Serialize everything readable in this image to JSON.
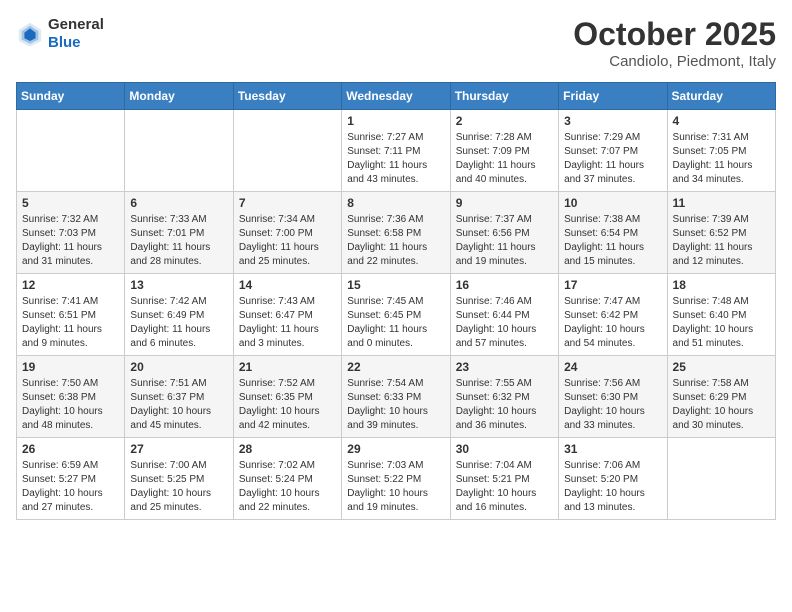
{
  "logo": {
    "general": "General",
    "blue": "Blue"
  },
  "title": "October 2025",
  "subtitle": "Candiolo, Piedmont, Italy",
  "days_of_week": [
    "Sunday",
    "Monday",
    "Tuesday",
    "Wednesday",
    "Thursday",
    "Friday",
    "Saturday"
  ],
  "weeks": [
    [
      {
        "num": "",
        "info": ""
      },
      {
        "num": "",
        "info": ""
      },
      {
        "num": "",
        "info": ""
      },
      {
        "num": "1",
        "info": "Sunrise: 7:27 AM\nSunset: 7:11 PM\nDaylight: 11 hours and 43 minutes."
      },
      {
        "num": "2",
        "info": "Sunrise: 7:28 AM\nSunset: 7:09 PM\nDaylight: 11 hours and 40 minutes."
      },
      {
        "num": "3",
        "info": "Sunrise: 7:29 AM\nSunset: 7:07 PM\nDaylight: 11 hours and 37 minutes."
      },
      {
        "num": "4",
        "info": "Sunrise: 7:31 AM\nSunset: 7:05 PM\nDaylight: 11 hours and 34 minutes."
      }
    ],
    [
      {
        "num": "5",
        "info": "Sunrise: 7:32 AM\nSunset: 7:03 PM\nDaylight: 11 hours and 31 minutes."
      },
      {
        "num": "6",
        "info": "Sunrise: 7:33 AM\nSunset: 7:01 PM\nDaylight: 11 hours and 28 minutes."
      },
      {
        "num": "7",
        "info": "Sunrise: 7:34 AM\nSunset: 7:00 PM\nDaylight: 11 hours and 25 minutes."
      },
      {
        "num": "8",
        "info": "Sunrise: 7:36 AM\nSunset: 6:58 PM\nDaylight: 11 hours and 22 minutes."
      },
      {
        "num": "9",
        "info": "Sunrise: 7:37 AM\nSunset: 6:56 PM\nDaylight: 11 hours and 19 minutes."
      },
      {
        "num": "10",
        "info": "Sunrise: 7:38 AM\nSunset: 6:54 PM\nDaylight: 11 hours and 15 minutes."
      },
      {
        "num": "11",
        "info": "Sunrise: 7:39 AM\nSunset: 6:52 PM\nDaylight: 11 hours and 12 minutes."
      }
    ],
    [
      {
        "num": "12",
        "info": "Sunrise: 7:41 AM\nSunset: 6:51 PM\nDaylight: 11 hours and 9 minutes."
      },
      {
        "num": "13",
        "info": "Sunrise: 7:42 AM\nSunset: 6:49 PM\nDaylight: 11 hours and 6 minutes."
      },
      {
        "num": "14",
        "info": "Sunrise: 7:43 AM\nSunset: 6:47 PM\nDaylight: 11 hours and 3 minutes."
      },
      {
        "num": "15",
        "info": "Sunrise: 7:45 AM\nSunset: 6:45 PM\nDaylight: 11 hours and 0 minutes."
      },
      {
        "num": "16",
        "info": "Sunrise: 7:46 AM\nSunset: 6:44 PM\nDaylight: 10 hours and 57 minutes."
      },
      {
        "num": "17",
        "info": "Sunrise: 7:47 AM\nSunset: 6:42 PM\nDaylight: 10 hours and 54 minutes."
      },
      {
        "num": "18",
        "info": "Sunrise: 7:48 AM\nSunset: 6:40 PM\nDaylight: 10 hours and 51 minutes."
      }
    ],
    [
      {
        "num": "19",
        "info": "Sunrise: 7:50 AM\nSunset: 6:38 PM\nDaylight: 10 hours and 48 minutes."
      },
      {
        "num": "20",
        "info": "Sunrise: 7:51 AM\nSunset: 6:37 PM\nDaylight: 10 hours and 45 minutes."
      },
      {
        "num": "21",
        "info": "Sunrise: 7:52 AM\nSunset: 6:35 PM\nDaylight: 10 hours and 42 minutes."
      },
      {
        "num": "22",
        "info": "Sunrise: 7:54 AM\nSunset: 6:33 PM\nDaylight: 10 hours and 39 minutes."
      },
      {
        "num": "23",
        "info": "Sunrise: 7:55 AM\nSunset: 6:32 PM\nDaylight: 10 hours and 36 minutes."
      },
      {
        "num": "24",
        "info": "Sunrise: 7:56 AM\nSunset: 6:30 PM\nDaylight: 10 hours and 33 minutes."
      },
      {
        "num": "25",
        "info": "Sunrise: 7:58 AM\nSunset: 6:29 PM\nDaylight: 10 hours and 30 minutes."
      }
    ],
    [
      {
        "num": "26",
        "info": "Sunrise: 6:59 AM\nSunset: 5:27 PM\nDaylight: 10 hours and 27 minutes."
      },
      {
        "num": "27",
        "info": "Sunrise: 7:00 AM\nSunset: 5:25 PM\nDaylight: 10 hours and 25 minutes."
      },
      {
        "num": "28",
        "info": "Sunrise: 7:02 AM\nSunset: 5:24 PM\nDaylight: 10 hours and 22 minutes."
      },
      {
        "num": "29",
        "info": "Sunrise: 7:03 AM\nSunset: 5:22 PM\nDaylight: 10 hours and 19 minutes."
      },
      {
        "num": "30",
        "info": "Sunrise: 7:04 AM\nSunset: 5:21 PM\nDaylight: 10 hours and 16 minutes."
      },
      {
        "num": "31",
        "info": "Sunrise: 7:06 AM\nSunset: 5:20 PM\nDaylight: 10 hours and 13 minutes."
      },
      {
        "num": "",
        "info": ""
      }
    ]
  ]
}
